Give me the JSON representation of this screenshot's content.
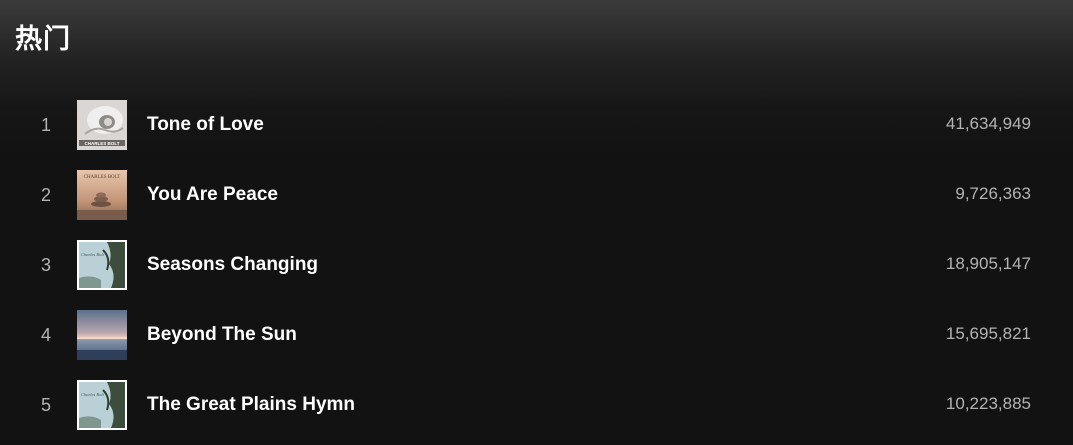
{
  "section": {
    "title": "热门"
  },
  "tracks": [
    {
      "number": "1",
      "title": "Tone of Love",
      "plays": "41,634,949",
      "cover": "cover-tone-of-love",
      "cover_text": "CHARLES BOLT"
    },
    {
      "number": "2",
      "title": "You Are Peace",
      "plays": "9,726,363",
      "cover": "cover-you-are-peace",
      "cover_text": "CHARLES BOLT"
    },
    {
      "number": "3",
      "title": "Seasons Changing",
      "plays": "18,905,147",
      "cover": "cover-seasons-changing",
      "cover_text": "Charles Bolt"
    },
    {
      "number": "4",
      "title": "Beyond The Sun",
      "plays": "15,695,821",
      "cover": "cover-beyond-the-sun",
      "cover_text": ""
    },
    {
      "number": "5",
      "title": "The Great Plains Hymn",
      "plays": "10,223,885",
      "cover": "cover-great-plains-hymn",
      "cover_text": "Charles Bolt"
    }
  ],
  "colors": {
    "background": "#121212",
    "header_gradient_top": "#3b3b3b",
    "text_primary": "#ffffff",
    "text_secondary": "#b3b3b3"
  }
}
